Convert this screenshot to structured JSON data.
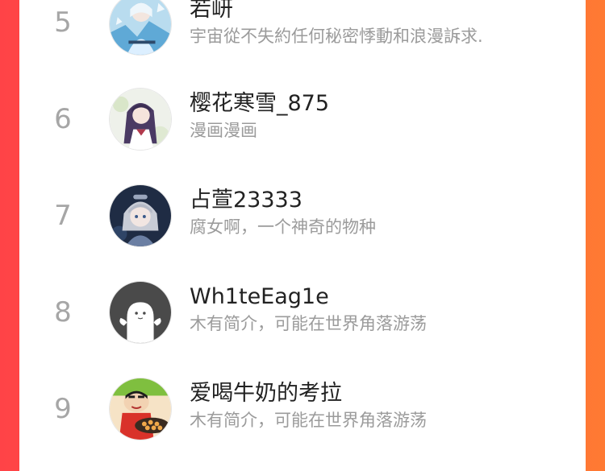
{
  "colors": {
    "background_left": "#ff4347",
    "background_right": "#ff7a33",
    "panel": "#ffffff",
    "rank_text": "#a6a6a6",
    "name_text": "#222222",
    "desc_text": "#9b9b9b"
  },
  "ranking": {
    "items": [
      {
        "rank": "5",
        "name": "若岍",
        "desc": "宇宙從不失約任何秘密悸動和浪漫訴求.",
        "avatar": "avatar-ice-princess"
      },
      {
        "rank": "6",
        "name": "樱花寒雪_875",
        "desc": "漫画漫画",
        "avatar": "avatar-purple-hair-girl"
      },
      {
        "rank": "7",
        "name": "占萱23333",
        "desc": "腐女啊，一个神奇的物种",
        "avatar": "avatar-anime-boy"
      },
      {
        "rank": "8",
        "name": "Wh1teEag1e",
        "desc": "木有简介，可能在世界角落游荡",
        "avatar": "avatar-default-ghost"
      },
      {
        "rank": "9",
        "name": "爱喝牛奶的考拉",
        "desc": "木有简介，可能在世界角落游荡",
        "avatar": "avatar-crayon-shin-chan"
      }
    ]
  }
}
